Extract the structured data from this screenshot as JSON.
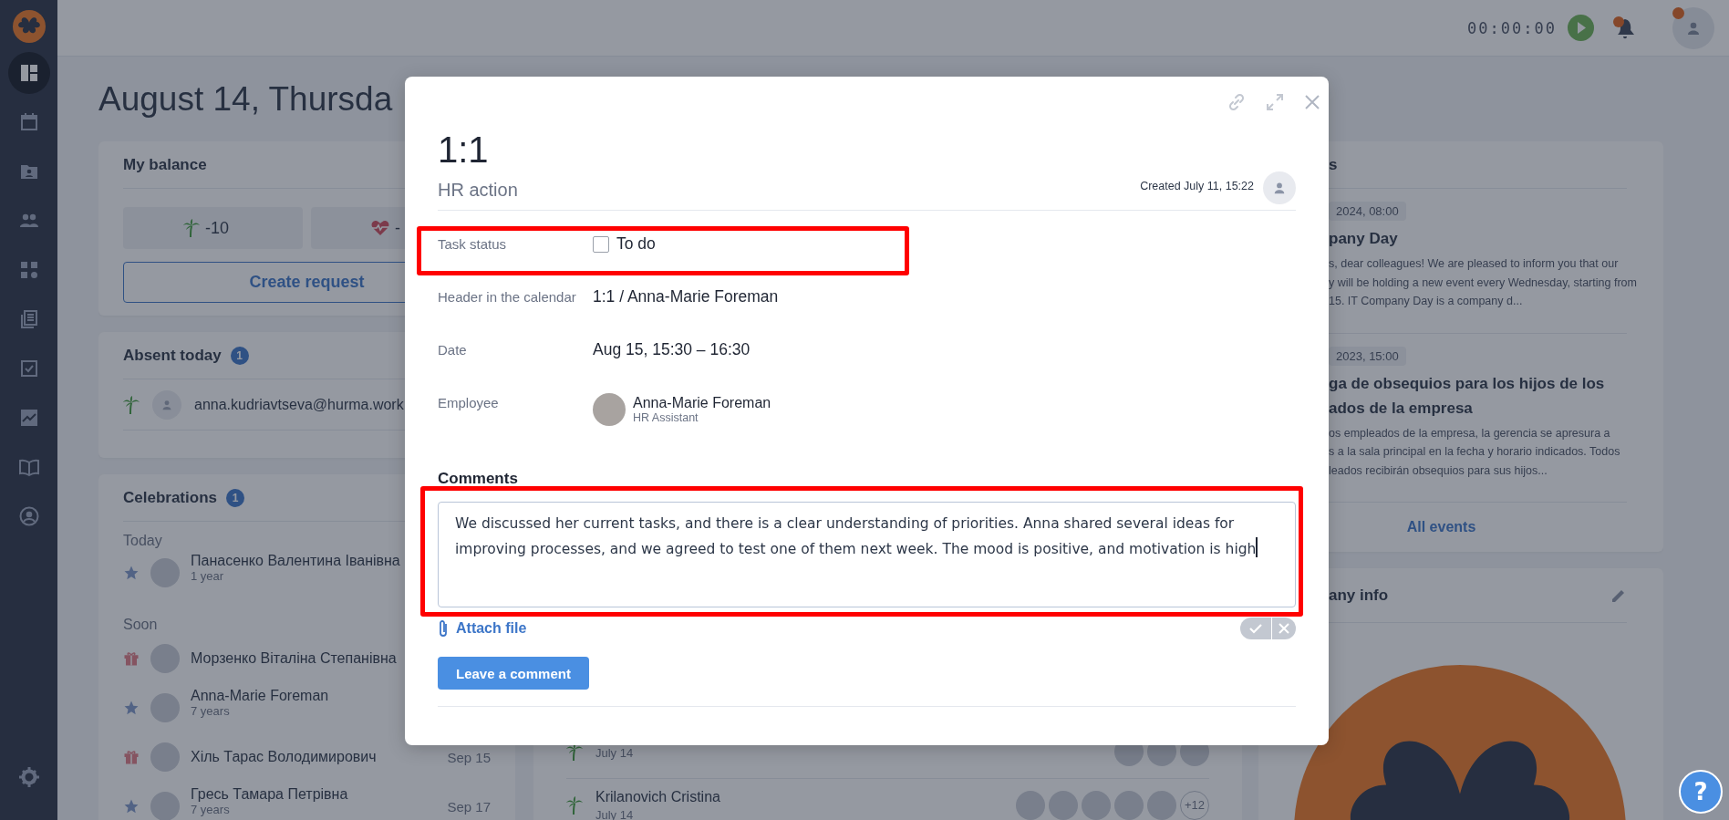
{
  "sidebar": {
    "items": [
      {
        "kind": "dashboard",
        "selected": true
      },
      {
        "kind": "calendar",
        "selected": false
      },
      {
        "kind": "profile",
        "selected": false
      },
      {
        "kind": "team",
        "selected": false
      },
      {
        "kind": "structure",
        "selected": false
      },
      {
        "kind": "documents",
        "selected": false
      },
      {
        "kind": "tasks",
        "selected": false
      },
      {
        "kind": "analytics",
        "selected": false
      },
      {
        "kind": "knowledge",
        "selected": false
      },
      {
        "kind": "account",
        "selected": false
      },
      {
        "kind": "settings",
        "selected": false
      }
    ]
  },
  "topbar": {
    "timer": "00:00:00",
    "notifications": {
      "unread": true
    },
    "profile": {
      "unread": true
    }
  },
  "page_title": "August 14, Thursda",
  "balance": {
    "title": "My balance",
    "chips": [
      {
        "kind": "vacation",
        "value": "-10"
      },
      {
        "kind": "sick",
        "value": "-"
      }
    ],
    "button": "Create request"
  },
  "absent": {
    "title": "Absent today",
    "count": "1",
    "people": [
      {
        "kind": "vacation",
        "email": "anna.kudriavtseva@hurma.work"
      }
    ]
  },
  "celebrations": {
    "title": "Celebrations",
    "count": "1",
    "groups": [
      {
        "label": "Today",
        "people": [
          {
            "kind": "anniversary",
            "name": "Панасенко Валентина Іванівна",
            "detail": "1 year"
          }
        ]
      },
      {
        "label": "Soon",
        "people": [
          {
            "kind": "birthday",
            "name": "Морзенко Віталіна Степанівна"
          },
          {
            "kind": "anniversary",
            "name": "Anna-Marie Foreman",
            "detail": "7 years"
          },
          {
            "kind": "birthday",
            "name": "Хіль Тарас Володимирович",
            "date": "Sep 15"
          },
          {
            "kind": "anniversary",
            "name": "Гресь Тамара Петрівна",
            "detail": "7 years",
            "date": "Sep 17"
          }
        ]
      }
    ]
  },
  "activity": {
    "rows": [
      {
        "kind": "vacation",
        "date": "July 14"
      },
      {
        "kind": "vacation",
        "name": "Krilanovich Cristina",
        "date": "July 14",
        "more": "+12"
      }
    ]
  },
  "events": {
    "title": "s",
    "items": [
      {
        "date": "2024, 08:00",
        "title": [
          "pany Day"
        ],
        "body": [
          "s, dear colleagues! We are pleased to inform you that our",
          "y will be holding a new event every Wednesday, starting from",
          "15. IT Company Day is a company d..."
        ]
      },
      {
        "date": "2023, 15:00",
        "title": [
          "ga de obsequios para los hijos de los",
          "ados de la empresa"
        ],
        "body": [
          "os empleados de la empresa, la gerencia se apresura a",
          "s a la sala principal en la fecha y horario indicados. Todos",
          "leados recibirán obsequios para sus hijos..."
        ]
      }
    ],
    "link": "All events"
  },
  "company": {
    "title": "any info"
  },
  "modal": {
    "title": "1:1",
    "subtitle": "HR action",
    "created": "Created July 11, 15:22",
    "fields": [
      {
        "kind": "checkbox",
        "label": "Task status",
        "value": "To do",
        "checked": false,
        "highlighted": true
      },
      {
        "kind": "text",
        "label": "Header in the calendar",
        "value": "1:1 / Anna-Marie Foreman",
        "highlighted": false
      },
      {
        "kind": "text",
        "label": "Date",
        "value": "Aug 15, 15:30 – 16:30",
        "highlighted": false
      },
      {
        "kind": "person",
        "label": "Employee",
        "name": "Anna-Marie Foreman",
        "role": "HR Assistant",
        "highlighted": false
      }
    ],
    "comments": {
      "label": "Comments",
      "value": "We discussed her current tasks, and there is a clear understanding of priorities. Anna shared several ideas for improving processes, and we agreed to test one of them next week. The mood is positive, and motivation is high",
      "highlighted": true,
      "attach": "Attach file",
      "submit": "Leave a comment"
    }
  },
  "help": {
    "label": "?"
  }
}
